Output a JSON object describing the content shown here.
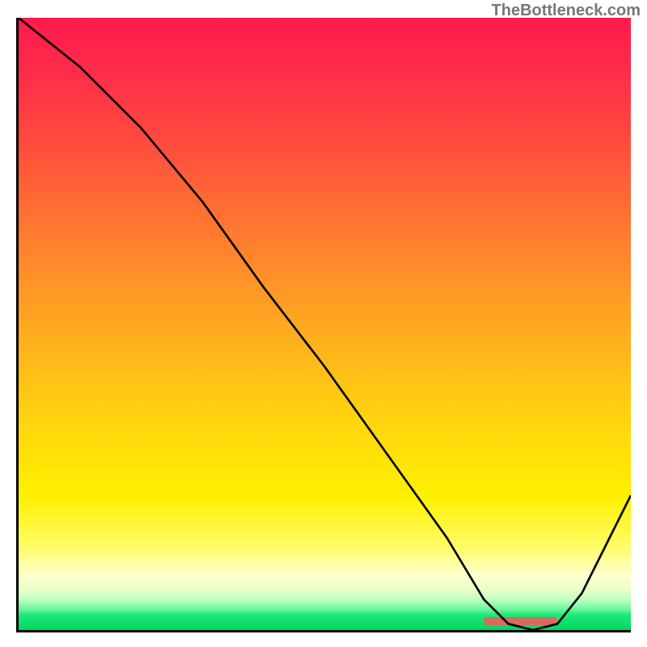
{
  "watermark": "TheBottleneck.com",
  "chart_data": {
    "type": "line",
    "title": "",
    "xlabel": "",
    "ylabel": "",
    "xlim": [
      0,
      100
    ],
    "ylim": [
      0,
      100
    ],
    "note": "y = bottleneck percentage (100 at top, 0 at bottom green band). Curve descends from top-left, reaches ~0 around x≈78–88, then rises. Background is a red→yellow→green heat gradient.",
    "x": [
      0,
      10,
      20,
      25,
      30,
      40,
      50,
      60,
      70,
      76,
      80,
      84,
      88,
      92,
      96,
      100
    ],
    "y": [
      100,
      92,
      82,
      76,
      70,
      56,
      43,
      29,
      15,
      5,
      1,
      0,
      1,
      6,
      14,
      22
    ],
    "optimal_range_x": [
      76,
      88
    ],
    "background_gradient_stops": [
      {
        "pos": 0,
        "color": "#ff1a4d"
      },
      {
        "pos": 0.35,
        "color": "#ff7a30"
      },
      {
        "pos": 0.65,
        "color": "#ffd210"
      },
      {
        "pos": 0.86,
        "color": "#fffc60"
      },
      {
        "pos": 0.95,
        "color": "#c0ffc0"
      },
      {
        "pos": 1.0,
        "color": "#00d860"
      }
    ]
  }
}
